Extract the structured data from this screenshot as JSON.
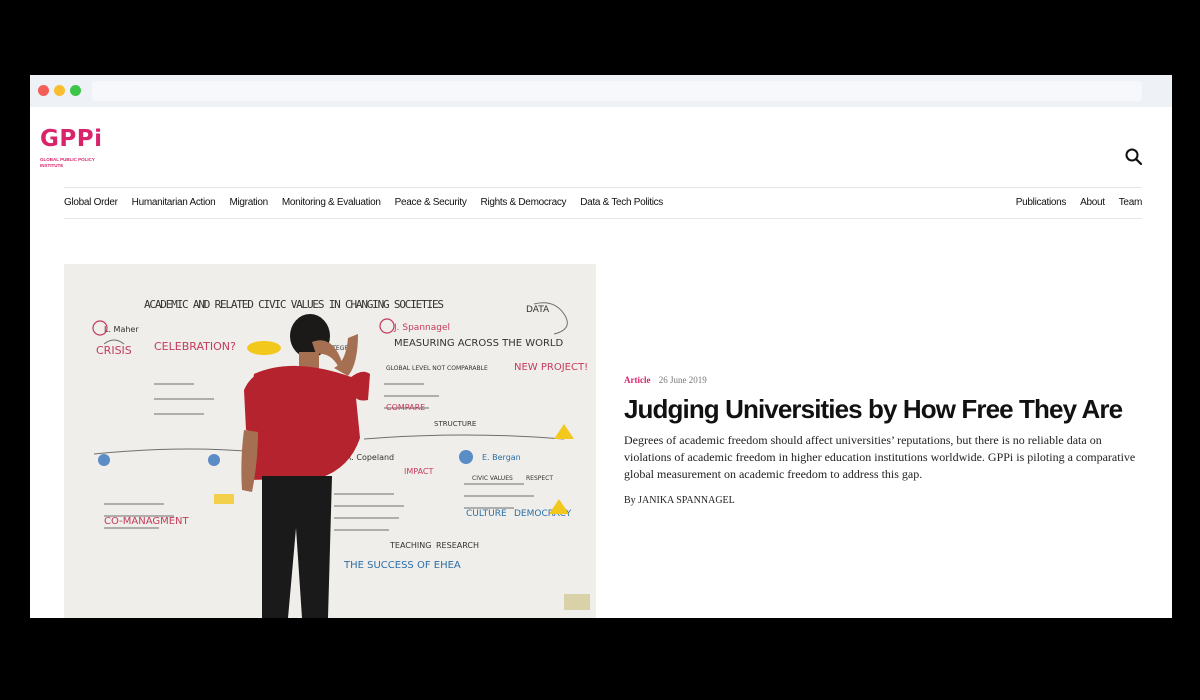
{
  "logo": {
    "word": "GPPi",
    "subtitle": "Global Public Policy Institute"
  },
  "nav": {
    "left": [
      "Global Order",
      "Humanitarian Action",
      "Migration",
      "Monitoring & Evaluation",
      "Peace & Security",
      "Rights & Democracy",
      "Data & Tech Politics"
    ],
    "right": [
      "Publications",
      "About",
      "Team"
    ]
  },
  "hero_image": {
    "wall_title": "ACADEMIC AND RELATED CIVIC VALUES IN CHANGING SOCIETIES",
    "notes": [
      "L. Maher",
      "CRISIS",
      "CELEBRATION?",
      "J. Spannagel",
      "MEASURING ACROSS THE WORLD",
      "NEW PROJECT!",
      "DATA",
      "GLOBAL LEVEL NOT COMPARABLE",
      "COMPARE",
      "STRUCTURE",
      "INTEGRITY",
      "IMPACT",
      "E. Bergan",
      "CIVIC VALUES",
      "RESPECT",
      "CULTURE",
      "DEMOCRACY",
      "CO-MANAGMENT",
      "TEACHING",
      "RESEARCH",
      "THE SUCCESS OF EHEA",
      "R. Copeland"
    ]
  },
  "article": {
    "type": "Article",
    "date": "26 June 2019",
    "title": "Judging Universities by How Free They Are",
    "summary": "Degrees of academic freedom should affect universities’ reputations, but there is no reliable data on violations of academic freedom in higher education institutions worldwide. GPPi is piloting a comparative global measurement on academic freedom to address this gap.",
    "byline": "By JANIKA SPANNAGEL"
  },
  "colors": {
    "brand": "#d9246c",
    "text": "#111111",
    "chrome": "#eef1f6"
  },
  "icons": {
    "search": "search-icon"
  }
}
